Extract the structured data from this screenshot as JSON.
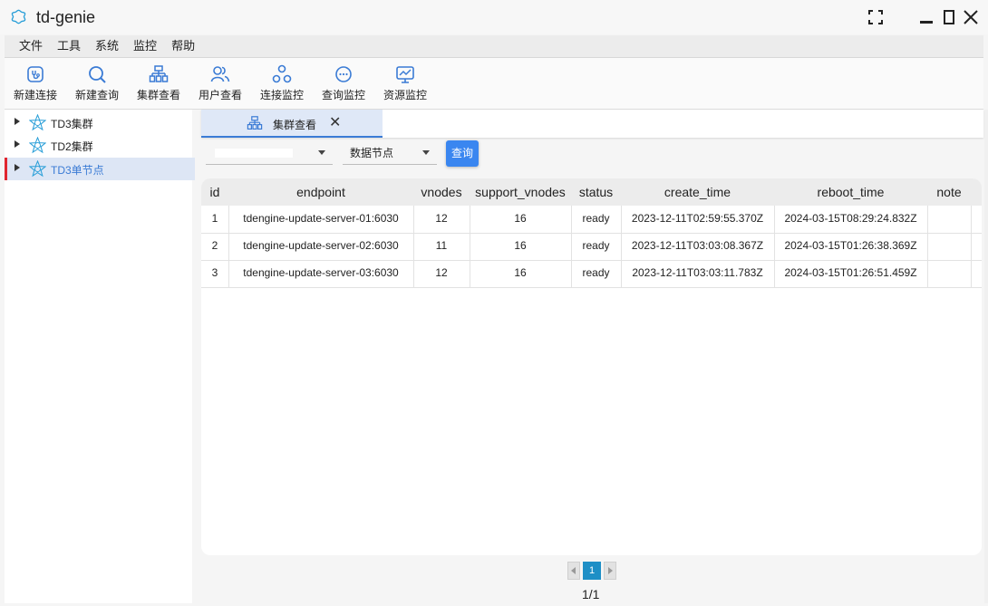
{
  "app": {
    "title": "td-genie"
  },
  "menu": [
    "文件",
    "工具",
    "系统",
    "监控",
    "帮助"
  ],
  "toolbar": [
    {
      "label": "新建连接",
      "icon": "stethoscope-icon"
    },
    {
      "label": "新建查询",
      "icon": "search-icon"
    },
    {
      "label": "集群查看",
      "icon": "cluster-icon"
    },
    {
      "label": "用户查看",
      "icon": "users-icon"
    },
    {
      "label": "连接监控",
      "icon": "connection-icon"
    },
    {
      "label": "查询监控",
      "icon": "chat-icon"
    },
    {
      "label": "资源监控",
      "icon": "monitor-icon"
    }
  ],
  "sidebar": {
    "items": [
      {
        "label": "TD3集群",
        "selected": false
      },
      {
        "label": "TD2集群",
        "selected": false
      },
      {
        "label": "TD3单节点",
        "selected": true
      }
    ]
  },
  "tab": {
    "label": "集群查看",
    "close": "✕"
  },
  "filters": {
    "first_value": "",
    "second_value": "数据节点",
    "query_label": "查询"
  },
  "table": {
    "columns": [
      "id",
      "endpoint",
      "vnodes",
      "support_vnodes",
      "status",
      "create_time",
      "reboot_time",
      "note"
    ],
    "rows": [
      [
        "1",
        "tdengine-update-server-01:6030",
        "12",
        "16",
        "ready",
        "2023-12-11T02:59:55.370Z",
        "2024-03-15T08:29:24.832Z",
        ""
      ],
      [
        "2",
        "tdengine-update-server-02:6030",
        "11",
        "16",
        "ready",
        "2023-12-11T03:03:08.367Z",
        "2024-03-15T01:26:38.369Z",
        ""
      ],
      [
        "3",
        "tdengine-update-server-03:6030",
        "12",
        "16",
        "ready",
        "2023-12-11T03:03:11.783Z",
        "2024-03-15T01:26:51.459Z",
        ""
      ]
    ]
  },
  "pagination": {
    "current": "1",
    "info": "1/1"
  },
  "colors": {
    "accent": "#3a7bd5",
    "button": "#3a86f0",
    "selected_marker": "#e0262f",
    "pager": "#1e8fc6"
  }
}
